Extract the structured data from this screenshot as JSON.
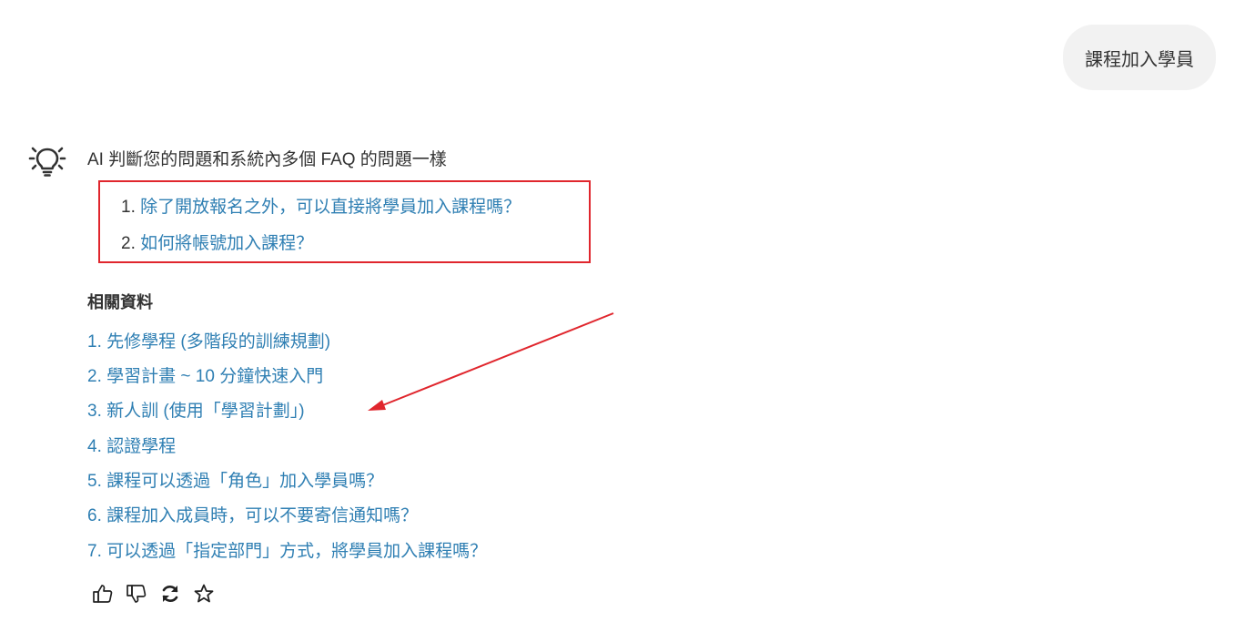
{
  "user_message": "課程加入學員",
  "ai": {
    "intro": "AI 判斷您的問題和系統內多個 FAQ 的問題一樣",
    "faq_items": [
      {
        "num": "1.",
        "text": "除了開放報名之外，可以直接將學員加入課程嗎？"
      },
      {
        "num": "2.",
        "text": "如何將帳號加入課程？"
      }
    ],
    "related_title": "相關資料",
    "related_items": [
      "1. 先修學程 (多階段的訓練規劃)",
      "2. 學習計畫 ~ 10 分鐘快速入門",
      "3. 新人訓 (使用「學習計劃」)",
      "4. 認證學程",
      "5. 課程可以透過「角色」加入學員嗎？",
      "6. 課程加入成員時，可以不要寄信通知嗎？",
      "7. 可以透過「指定部門」方式，將學員加入課程嗎？"
    ],
    "actions": [
      "thumbs-up-icon",
      "thumbs-down-icon",
      "refresh-icon",
      "star-icon"
    ]
  },
  "colors": {
    "link": "#2f7fb3",
    "annotation_red": "#e0262d",
    "bubble_bg": "#f2f2f2",
    "text": "#333333"
  }
}
